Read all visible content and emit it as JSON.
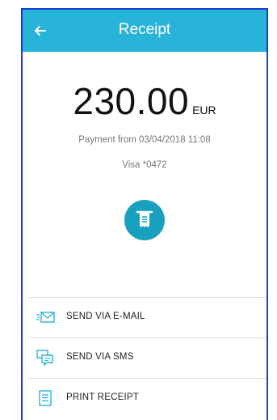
{
  "header": {
    "title": "Receipt",
    "back_icon": "back-arrow-icon"
  },
  "payment": {
    "amount": "230.00",
    "currency": "EUR",
    "description": "Payment from 03/04/2018 11:08",
    "card": "Visa *0472",
    "receipt_icon": "receipt-icon"
  },
  "actions": [
    {
      "label": "SEND VIA E-MAIL",
      "icon": "email-icon"
    },
    {
      "label": "SEND VIA SMS",
      "icon": "sms-icon"
    },
    {
      "label": "PRINT RECEIPT",
      "icon": "print-receipt-icon"
    }
  ],
  "colors": {
    "header": "#28b3d9",
    "accent": "#1aa0bf",
    "frame": "#1a3fd6"
  }
}
